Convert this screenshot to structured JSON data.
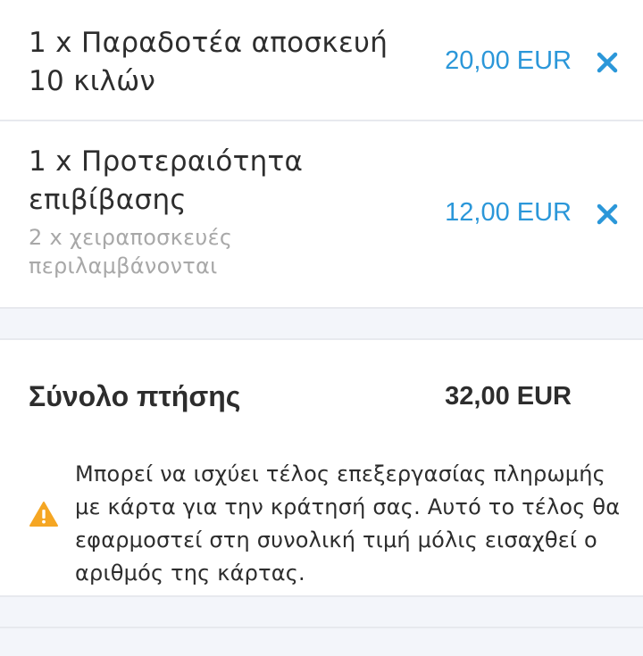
{
  "items": [
    {
      "title": "1 x Παραδοτέα αποσκευή 10 κιλών",
      "price": "20,00 EUR",
      "remove_icon": "close-icon"
    },
    {
      "title": "1 x Προτεραιότητα επιβίβασης",
      "note": "2 x χειραποσκευές περιλαμβάνονται",
      "price": "12,00 EUR",
      "remove_icon": "close-icon"
    }
  ],
  "summary": {
    "total_label": "Σύνολο πτήσης",
    "total_value": "32,00 EUR",
    "warning_icon": "warning-icon",
    "warning_text": "Μπορεί να ισχύει τέλος επεξεργασίας πληρωμής με κάρτα για την κράτησή σας. Αυτό το τέλος θα εφαρμοστεί στη συνολική τιμή μόλις εισαχθεί ο αριθμός της κάρτας."
  },
  "colors": {
    "accent": "#2b97d9",
    "warning": "#f5a623",
    "text": "#2d2d2d",
    "muted": "#a8a8a8"
  }
}
